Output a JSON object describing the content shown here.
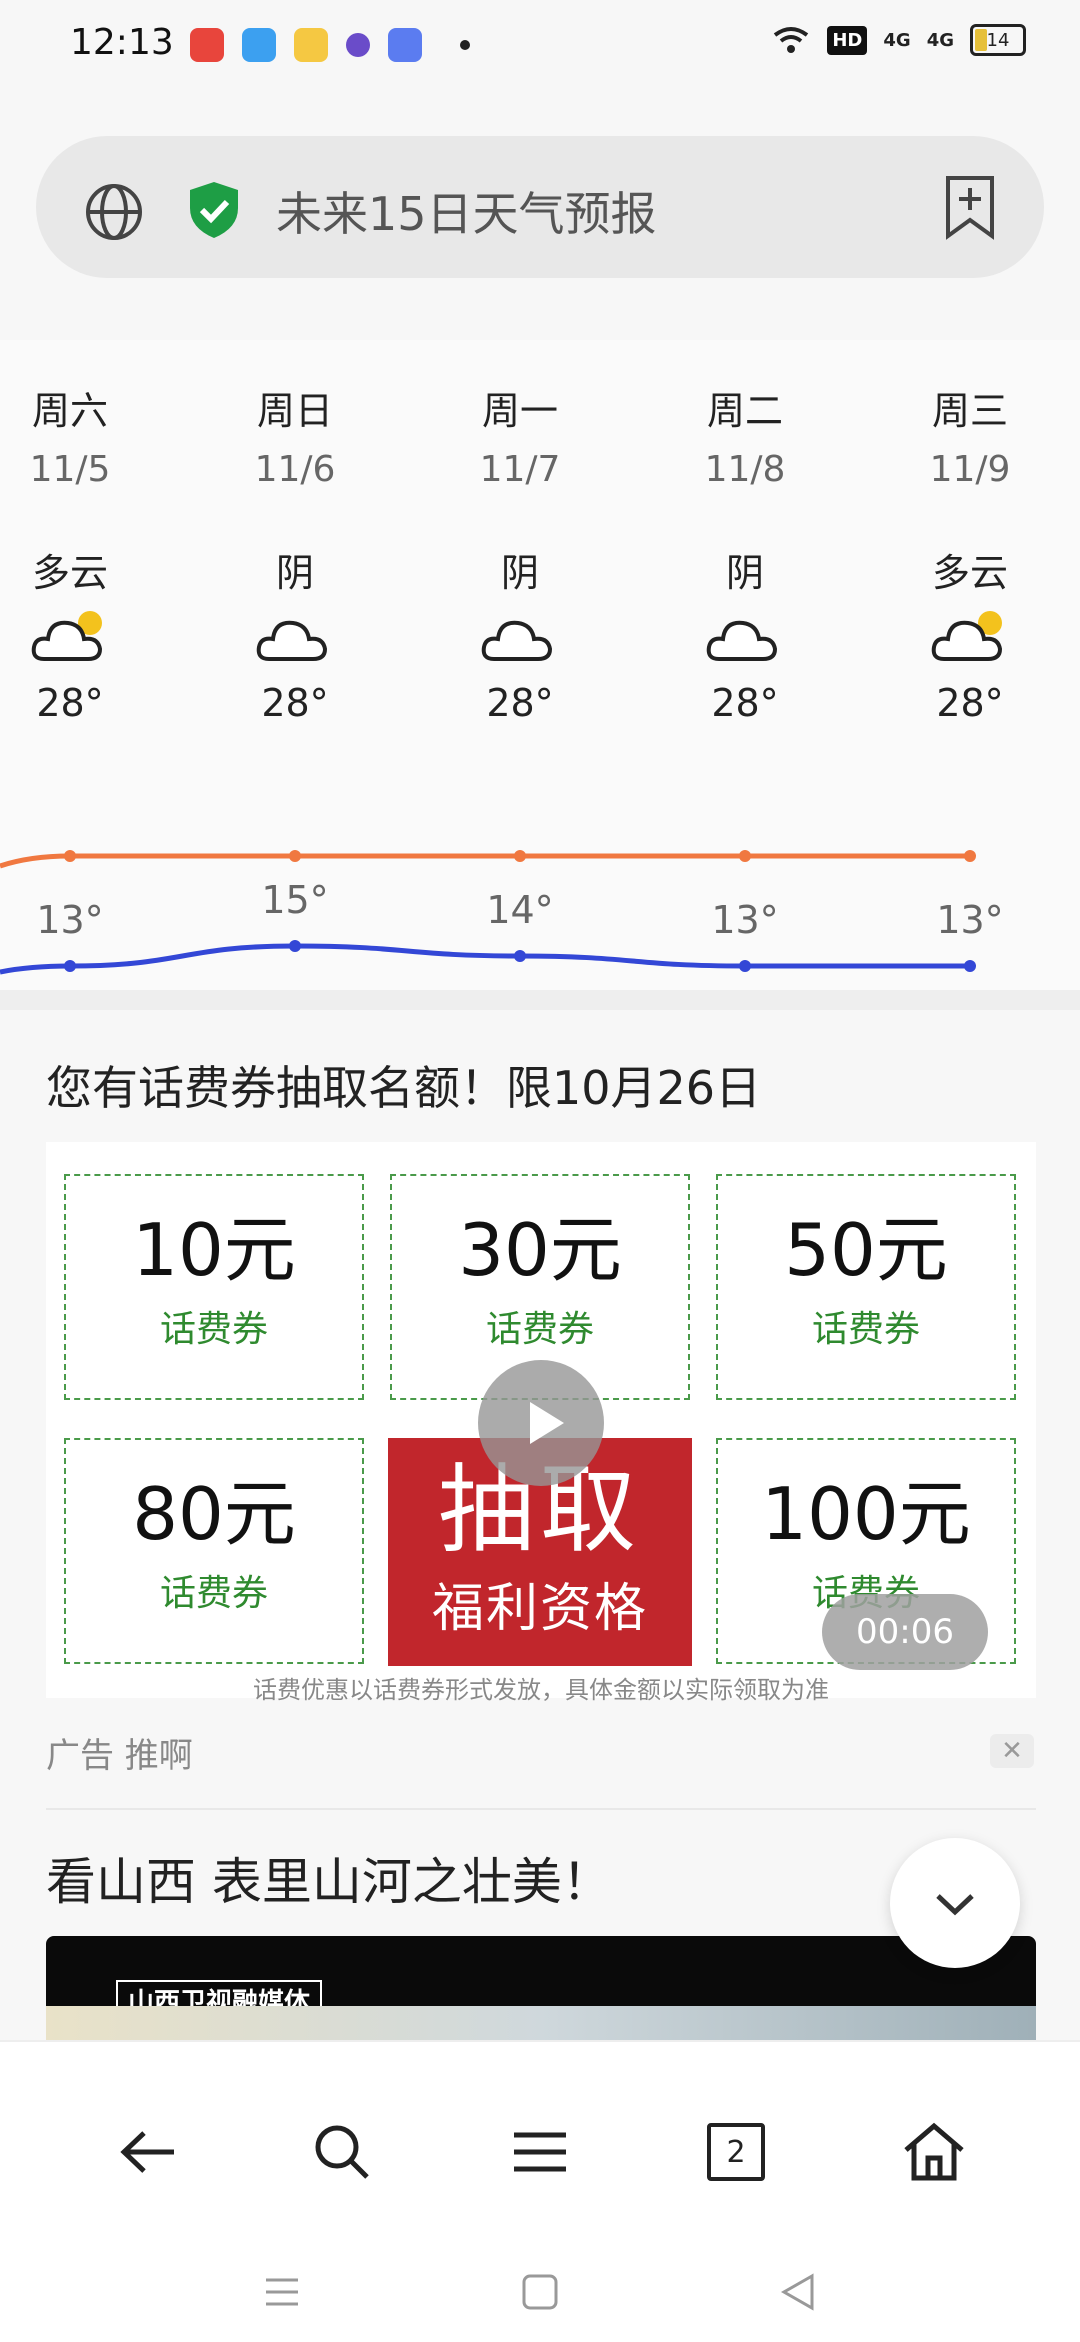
{
  "status_bar": {
    "time": "12:13",
    "network_label": "HD",
    "signal1": "4G",
    "signal2": "4G",
    "battery": "14"
  },
  "address_bar": {
    "text": "未来15日天气预报"
  },
  "forecast": {
    "days": [
      {
        "weekday": "周六",
        "date": "11/5",
        "condition": "多云",
        "icon": "partly-cloudy",
        "high": "28°",
        "low": "13°"
      },
      {
        "weekday": "周日",
        "date": "11/6",
        "condition": "阴",
        "icon": "cloudy",
        "high": "28°",
        "low": "15°"
      },
      {
        "weekday": "周一",
        "date": "11/7",
        "condition": "阴",
        "icon": "cloudy",
        "high": "28°",
        "low": "14°"
      },
      {
        "weekday": "周二",
        "date": "11/8",
        "condition": "阴",
        "icon": "cloudy",
        "high": "28°",
        "low": "13°"
      },
      {
        "weekday": "周三",
        "date": "11/9",
        "condition": "多云",
        "icon": "partly-cloudy",
        "high": "28°",
        "low": "13°"
      }
    ],
    "high_color": "#f07840",
    "low_color": "#3347d6"
  },
  "ad": {
    "title": "您有话费券抽取名额！限10月26日",
    "coupons": [
      {
        "amount": "10元",
        "label": "话费券"
      },
      {
        "amount": "30元",
        "label": "话费券"
      },
      {
        "amount": "50元",
        "label": "话费券"
      },
      {
        "amount": "80元",
        "label": "话费券"
      },
      {
        "amount": "100元",
        "label": "话费券"
      }
    ],
    "draw_big": "抽取",
    "draw_small": "福利资格",
    "timer": "00:06",
    "disclaimer": "话费优惠以话费券形式发放，具体金额以实际领取为准",
    "label": "广告  推啊",
    "close": "✕"
  },
  "news": {
    "title": "看山西 表里山河之壮美！",
    "logo_text": "山西卫视融媒体"
  },
  "bottom_nav": {
    "tab_count": "2"
  }
}
